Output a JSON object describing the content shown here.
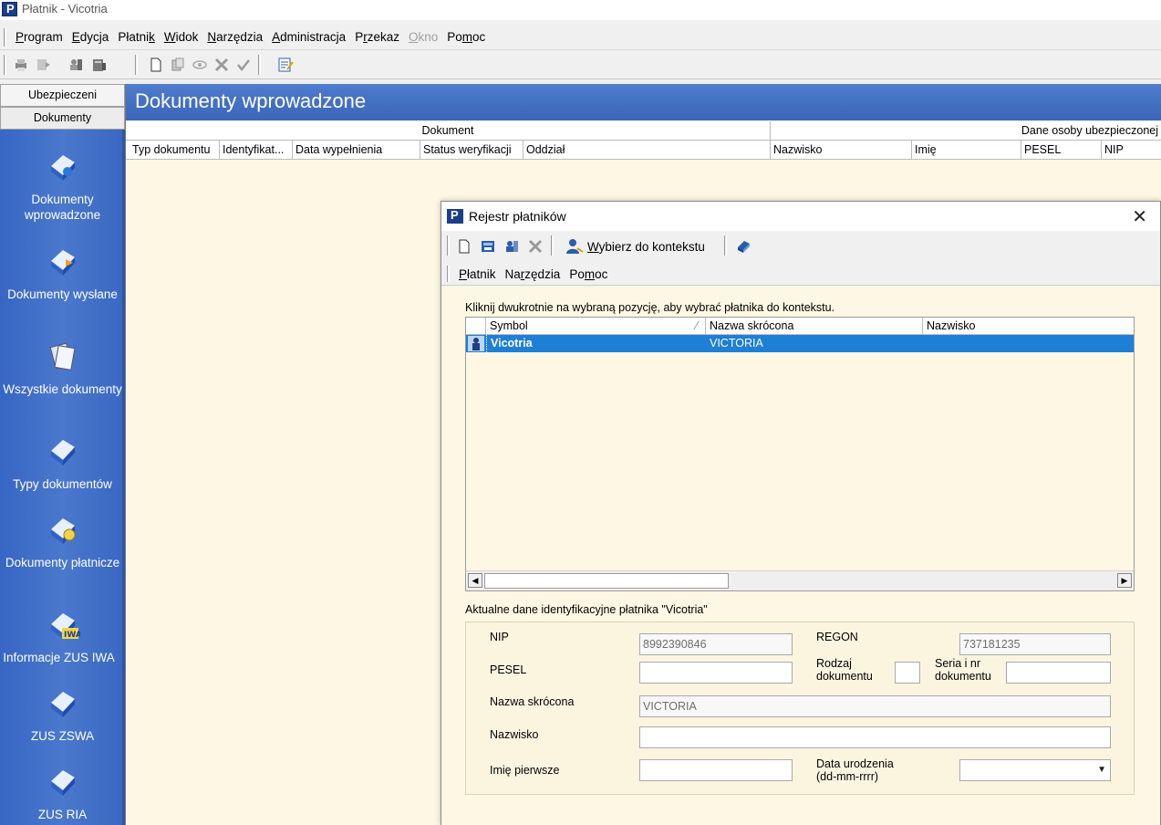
{
  "window": {
    "title": "Płatnik - Vicotria",
    "app_icon_letter": "P"
  },
  "menu": [
    {
      "label": "Program",
      "u": 0
    },
    {
      "label": "Edycja",
      "u": 0
    },
    {
      "label": "Płatnik",
      "u": 6
    },
    {
      "label": "Widok",
      "u": 0
    },
    {
      "label": "Narzędzia",
      "u": 0
    },
    {
      "label": "Administracja",
      "u": 0
    },
    {
      "label": "Przekaz",
      "u": 1
    },
    {
      "label": "Okno",
      "u": 0,
      "disabled": true
    },
    {
      "label": "Pomoc",
      "u": 2
    }
  ],
  "left_panel": {
    "tabs": [
      "Ubezpieczeni",
      "Dokumenty"
    ],
    "items": [
      "Dokumenty wprowadzone",
      "Dokumenty wysłane",
      "Wszystkie dokumenty",
      "Typy dokumentów",
      "Dokumenty płatnicze",
      "Informacje ZUS IWA",
      "ZUS ZSWA",
      "ZUS RIA"
    ],
    "icon_badge": "IWA"
  },
  "main": {
    "title": "Dokumenty wprowadzone",
    "group_headers": [
      "Dokument",
      "Dane osoby ubezpieczonej"
    ],
    "columns": [
      "Typ dokumentu",
      "Identyfikat...",
      "Data wypełnienia",
      "Status weryfikacji",
      "Oddział",
      "Nazwisko",
      "Imię",
      "PESEL",
      "NIP"
    ]
  },
  "dialog": {
    "title": "Rejestr płatników",
    "close_glyph": "✕",
    "toolbar": {
      "select_label": "Wybierz do kontekstu"
    },
    "menu": [
      {
        "label": "Płatnik",
        "u": 0
      },
      {
        "label": "Narzędzia",
        "u": 2
      },
      {
        "label": "Pomoc",
        "u": 2
      }
    ],
    "hint": "Kliknij dwukrotnie na wybraną pozycję, aby wybrać płatnika do kontekstu.",
    "list_columns": [
      "Symbol",
      "Nazwa skrócona",
      "Nazwisko"
    ],
    "sort_glyph": "⁄",
    "rows": [
      {
        "symbol": "Vicotria",
        "nazwa": "VICTORIA",
        "nazwisko": ""
      }
    ],
    "ident_title": "Aktualne dane identyfikacyjne płatnika \"Vicotria\"",
    "fields": {
      "nip_label": "NIP",
      "nip": "8992390846",
      "regon_label": "REGON",
      "regon": "737181235",
      "pesel_label": "PESEL",
      "pesel": "",
      "rodzaj_label_1": "Rodzaj",
      "rodzaj_label_2": "dokumentu",
      "rodzaj": "",
      "seria_label_1": "Seria i nr",
      "seria_label_2": "dokumentu",
      "seria": "",
      "nazwa_label": "Nazwa skrócona",
      "nazwa": "VICTORIA",
      "nazwisko_label": "Nazwisko",
      "nazwisko": "",
      "imie_label": "Imię pierwsze",
      "imie": "",
      "data_label_1": "Data urodzenia",
      "data_label_2": "(dd-mm-rrrr)",
      "data": ""
    }
  },
  "colors": {
    "panel_blue": "#3f6cc0",
    "header_blue": "#4a76c8",
    "cream": "#fdf7e3",
    "selection": "#1e7fd6"
  }
}
